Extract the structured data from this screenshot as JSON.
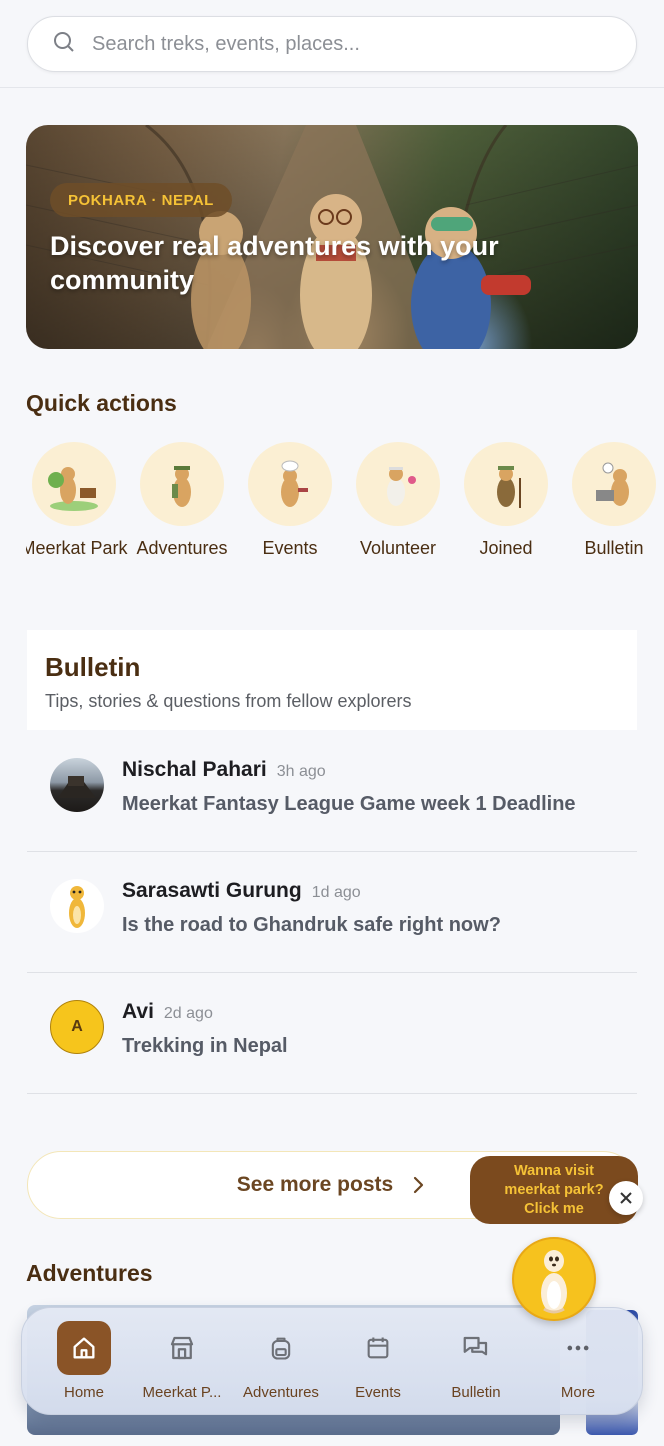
{
  "search": {
    "placeholder": "Search treks, events, places..."
  },
  "hero": {
    "badge": "POKHARA · NEPAL",
    "title": "Discover real adventures with your community"
  },
  "quick_actions": {
    "title": "Quick actions",
    "items": [
      {
        "label": "Meerkat Park",
        "icon": "meerkat-park-icon"
      },
      {
        "label": "Adventures",
        "icon": "adventurer-meerkat-icon"
      },
      {
        "label": "Events",
        "icon": "chef-meerkat-icon"
      },
      {
        "label": "Volunteer",
        "icon": "volunteer-meerkat-icon"
      },
      {
        "label": "Joined",
        "icon": "hiker-meerkat-icon"
      },
      {
        "label": "Bulletin",
        "icon": "laptop-meerkat-icon"
      }
    ]
  },
  "bulletin": {
    "title": "Bulletin",
    "subtitle": "Tips, stories & questions from fellow explorers",
    "posts": [
      {
        "author": "Nischal Pahari",
        "time": "3h ago",
        "message": "Meerkat Fantasy League Game week 1 Deadline",
        "avatar": "photo"
      },
      {
        "author": "Sarasawti Gurung",
        "time": "1d ago",
        "message": "Is the road to Ghandruk safe right now?",
        "avatar": "meerkat"
      },
      {
        "author": "Avi",
        "time": "2d ago",
        "message": "Trekking in Nepal",
        "avatar_initial": "A"
      }
    ],
    "see_more": "See more posts"
  },
  "promo": {
    "line1": "Wanna visit",
    "line2": "meerkat park?",
    "line3": "Click me"
  },
  "adventures": {
    "title": "Adventures"
  },
  "nav": {
    "items": [
      {
        "label": "Home",
        "active": true
      },
      {
        "label": "Meerkat P..."
      },
      {
        "label": "Adventures"
      },
      {
        "label": "Events"
      },
      {
        "label": "Bulletin"
      },
      {
        "label": "More"
      }
    ]
  },
  "colors": {
    "brand_brown": "#8a5427",
    "accent_yellow": "#f5c236",
    "cream": "#fbefd3"
  }
}
